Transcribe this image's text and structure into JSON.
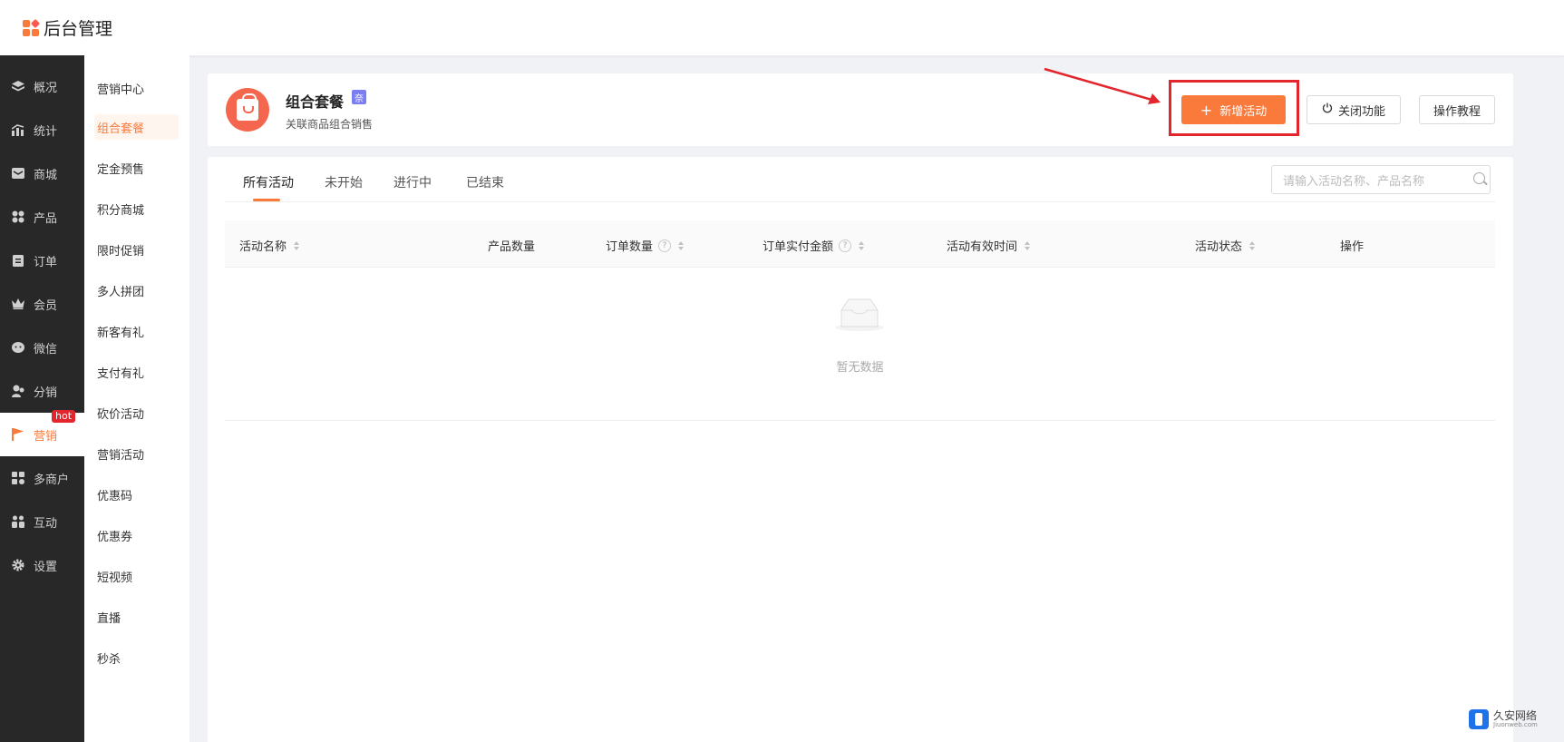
{
  "app": {
    "title": "后台管理"
  },
  "primary_nav": [
    {
      "label": "概况",
      "icon": "layers-icon"
    },
    {
      "label": "统计",
      "icon": "chart-icon"
    },
    {
      "label": "商城",
      "icon": "mail-icon"
    },
    {
      "label": "产品",
      "icon": "grid-icon"
    },
    {
      "label": "订单",
      "icon": "clipboard-icon"
    },
    {
      "label": "会员",
      "icon": "crown-icon"
    },
    {
      "label": "微信",
      "icon": "wechat-icon"
    },
    {
      "label": "分销",
      "icon": "users-icon"
    },
    {
      "label": "营销",
      "icon": "flag-icon",
      "active": true,
      "badge": "hot"
    },
    {
      "label": "多商户",
      "icon": "store-icon"
    },
    {
      "label": "互动",
      "icon": "people-icon"
    },
    {
      "label": "设置",
      "icon": "gear-icon"
    }
  ],
  "secondary_nav": [
    {
      "label": "营销中心"
    },
    {
      "label": "组合套餐",
      "active": true
    },
    {
      "label": "定金预售"
    },
    {
      "label": "积分商城"
    },
    {
      "label": "限时促销"
    },
    {
      "label": "多人拼团"
    },
    {
      "label": "新客有礼"
    },
    {
      "label": "支付有礼"
    },
    {
      "label": "砍价活动"
    },
    {
      "label": "营销活动"
    },
    {
      "label": "优惠码"
    },
    {
      "label": "优惠券"
    },
    {
      "label": "短视频"
    },
    {
      "label": "直播"
    },
    {
      "label": "秒杀"
    }
  ],
  "header": {
    "title": "组合套餐",
    "badge": "奈",
    "subtitle": "关联商品组合销售",
    "add_button": "新增活动",
    "close_button": "关闭功能",
    "tutorial_button": "操作教程"
  },
  "tabs": [
    {
      "label": "所有活动",
      "active": true
    },
    {
      "label": "未开始"
    },
    {
      "label": "进行中"
    },
    {
      "label": "已结束"
    }
  ],
  "search": {
    "placeholder": "请输入活动名称、产品名称"
  },
  "table": {
    "columns": [
      {
        "label": "活动名称",
        "sortable": true
      },
      {
        "label": "产品数量"
      },
      {
        "label": "订单数量",
        "help": true,
        "sortable": true
      },
      {
        "label": "订单实付金额",
        "help": true,
        "sortable": true
      },
      {
        "label": "活动有效时间",
        "sortable": true
      },
      {
        "label": "活动状态",
        "sortable": true
      },
      {
        "label": "操作"
      }
    ],
    "rows": [],
    "empty_text": "暂无数据"
  },
  "watermark": {
    "text": "久安网络",
    "sub": "Jiuonweb.com"
  },
  "colors": {
    "accent": "#f97a3b",
    "sidebar": "#282828",
    "highlight": "#e3262e"
  }
}
